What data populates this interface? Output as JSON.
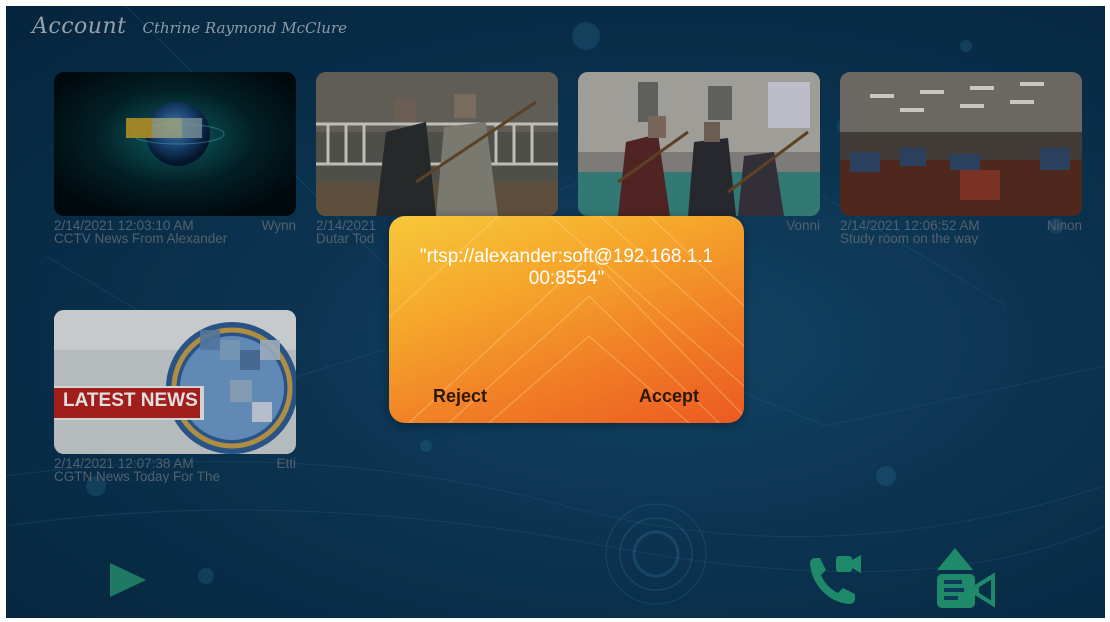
{
  "header": {
    "account_label": "Account",
    "account_name": "Cthrine Raymond McClure"
  },
  "tiles": [
    {
      "timestamp": "2/14/2021 12:03:10 AM",
      "user": "Wynn",
      "title": "CCTV News From Alexander"
    },
    {
      "timestamp": "2/14/2021",
      "user": "",
      "title": "Dutar Tod"
    },
    {
      "timestamp": "",
      "user": "Vonni",
      "title": ""
    },
    {
      "timestamp": "2/14/2021 12:06:52 AM",
      "user": "Ninon",
      "title": "Study room on the way"
    },
    {
      "timestamp": "2/14/2021 12:07:38 AM",
      "user": "Etti",
      "title": "CGTN News Today For The",
      "thumb_text": "LATEST NEWS"
    }
  ],
  "dialog": {
    "message": "\"rtsp://alexander:soft@192.168.1.100:8554\"",
    "reject_label": "Reject",
    "accept_label": "Accept"
  },
  "bottom_bar": {
    "icons": [
      "play-icon",
      "video-call-icon",
      "upload-video-icon"
    ]
  },
  "colors": {
    "background": "#0d3a5a",
    "accent_green": "#1f8a6a",
    "dialog_orange": "#f07a25",
    "meta_text": "#5f6f7e"
  }
}
